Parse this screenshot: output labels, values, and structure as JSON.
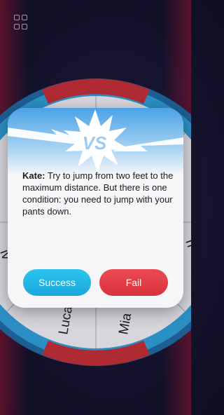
{
  "toolbar": {
    "menu_icon": "grid-icon"
  },
  "wheel": {
    "segments": [
      "Lucas",
      "Mia"
    ],
    "left_partial": "iv",
    "right_partial": "n",
    "colors": {
      "rim": "#2c8fc4",
      "rim_red": "#b02a34",
      "face": "#d6d6dc"
    }
  },
  "modal": {
    "banner_label": "VS",
    "player_name": "Kate:",
    "challenge": " Try to jump from two feet to the maximum distance. But there is one condition: you need to jump with your pants down.",
    "success_label": "Success",
    "fail_label": "Fail"
  },
  "colors": {
    "success": "#22b8e8",
    "fail": "#e23b44"
  }
}
